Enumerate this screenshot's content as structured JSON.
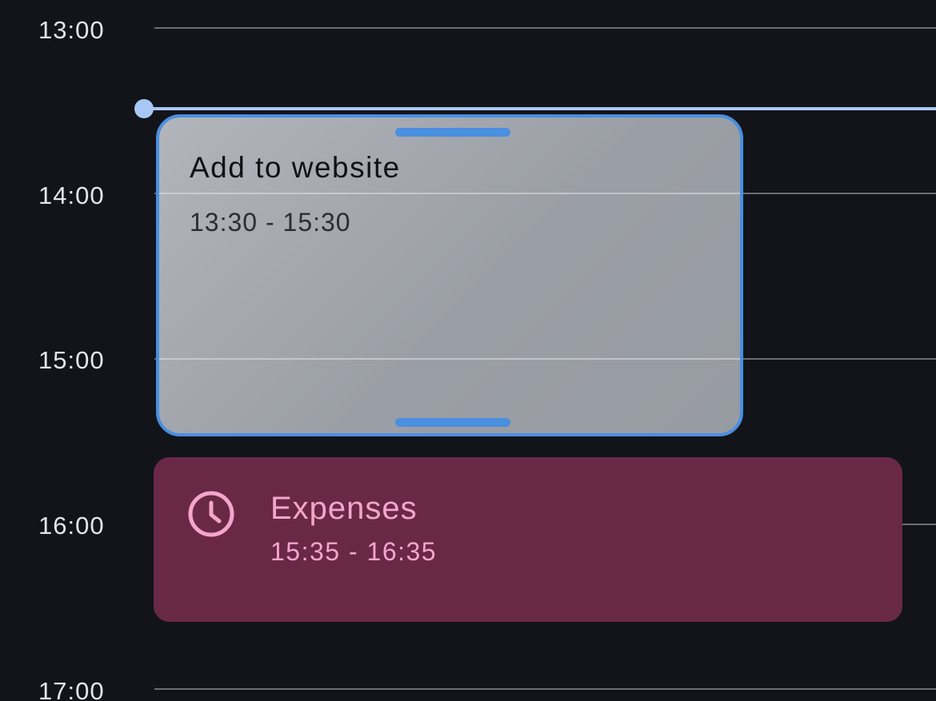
{
  "timeline": {
    "hours": [
      "13:00",
      "14:00",
      "15:00",
      "16:00",
      "17:00"
    ]
  },
  "events": {
    "selected": {
      "title": "Add to website",
      "time": "13:30 - 15:30",
      "accent_color": "#4a8fe0"
    },
    "expenses": {
      "title": "Expenses",
      "time": "15:35 - 16:35",
      "icon": "clock-icon",
      "background_color": "#6a2847",
      "text_color": "#f3a5cc"
    }
  },
  "now_indicator": {
    "color": "#a7c8f4"
  },
  "theme": {
    "background": "#121419"
  }
}
